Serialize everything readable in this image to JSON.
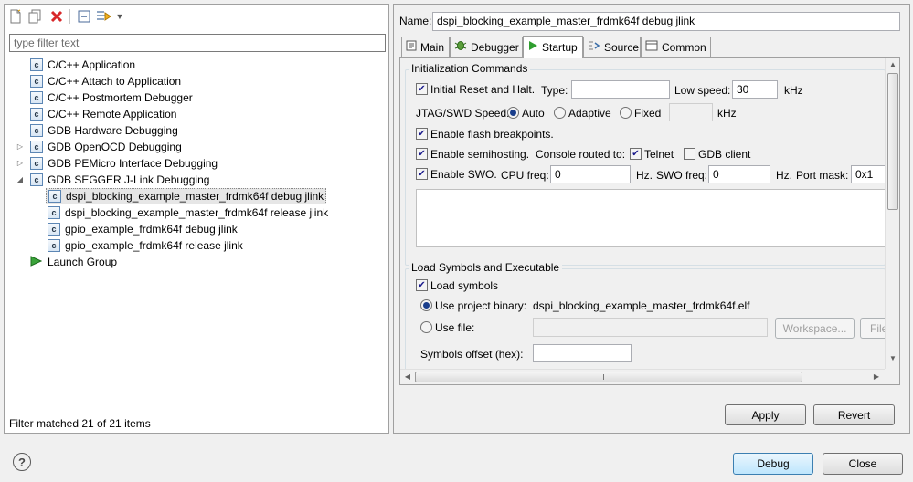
{
  "toolbar": {
    "icons": [
      "new-configuration-icon",
      "duplicate-icon",
      "delete-icon",
      "collapse-all-icon",
      "filter-icon",
      "dropdown-icon"
    ]
  },
  "filter": {
    "placeholder": "type filter text"
  },
  "tree": {
    "items": [
      {
        "label": "C/C++ Application",
        "icon": "c-icon"
      },
      {
        "label": "C/C++ Attach to Application",
        "icon": "c-icon"
      },
      {
        "label": "C/C++ Postmortem Debugger",
        "icon": "c-icon"
      },
      {
        "label": "C/C++ Remote Application",
        "icon": "c-icon"
      },
      {
        "label": "GDB Hardware Debugging",
        "icon": "c-icon"
      },
      {
        "label": "GDB OpenOCD Debugging",
        "icon": "c-icon",
        "expander": "collapsed"
      },
      {
        "label": "GDB PEMicro Interface Debugging",
        "icon": "c-icon",
        "expander": "collapsed"
      },
      {
        "label": "GDB SEGGER J-Link Debugging",
        "icon": "c-icon",
        "expander": "expanded"
      },
      {
        "label": "dspi_blocking_example_master_frdmk64f debug jlink",
        "icon": "c-icon",
        "child": true,
        "selected": true
      },
      {
        "label": "dspi_blocking_example_master_frdmk64f release jlink",
        "icon": "c-icon",
        "child": true
      },
      {
        "label": "gpio_example_frdmk64f debug jlink",
        "icon": "c-icon",
        "child": true
      },
      {
        "label": "gpio_example_frdmk64f release jlink",
        "icon": "c-icon",
        "child": true
      },
      {
        "label": "Launch Group",
        "icon": "launch-icon"
      }
    ]
  },
  "filter_status": "Filter matched 21 of 21 items",
  "name": {
    "label": "Name:",
    "value": "dspi_blocking_example_master_frdmk64f debug jlink"
  },
  "tabs": [
    {
      "label": "Main",
      "icon": "main-icon"
    },
    {
      "label": "Debugger",
      "icon": "debugger-icon"
    },
    {
      "label": "Startup",
      "icon": "startup-icon",
      "active": true
    },
    {
      "label": "Source",
      "icon": "source-icon"
    },
    {
      "label": "Common",
      "icon": "common-icon"
    }
  ],
  "init": {
    "title": "Initialization Commands",
    "initial_reset": {
      "label": "Initial Reset and Halt.",
      "checked": true
    },
    "type_label": "Type:",
    "type_value": "",
    "low_speed_label": "Low speed:",
    "low_speed_value": "30",
    "khz": "kHz",
    "jtag_label": "JTAG/SWD Speed:",
    "speed_options": [
      {
        "label": "Auto",
        "selected": true
      },
      {
        "label": "Adaptive",
        "selected": false
      },
      {
        "label": "Fixed",
        "selected": false
      }
    ],
    "fixed_value": "",
    "khz2": "kHz",
    "flash_bp": {
      "label": "Enable flash breakpoints.",
      "checked": true
    },
    "semihosting": {
      "label": "Enable semihosting.",
      "checked": true
    },
    "console_label": "Console routed to:",
    "telnet": {
      "label": "Telnet",
      "checked": true
    },
    "gdb_client": {
      "label": "GDB client",
      "checked": false
    },
    "swo": {
      "label": "Enable SWO.",
      "checked": true
    },
    "cpu_freq_label": "CPU freq:",
    "cpu_freq_value": "0",
    "hz1": "Hz.",
    "swo_freq_label": "SWO freq:",
    "swo_freq_value": "0",
    "hz2": "Hz.",
    "port_mask_label": "Port mask:",
    "port_mask_value": "0x1",
    "commands_text": ""
  },
  "load": {
    "title": "Load Symbols and Executable",
    "load_symbols": {
      "label": "Load symbols",
      "checked": true
    },
    "use_project": {
      "label": "Use project binary:",
      "selected": true
    },
    "project_binary": "dspi_blocking_example_master_frdmk64f.elf",
    "use_file": {
      "label": "Use file:",
      "selected": false
    },
    "file_value": "",
    "workspace_button": "Workspace...",
    "file_button": "File",
    "offset_label": "Symbols offset (hex):",
    "offset_value": ""
  },
  "buttons": {
    "apply": "Apply",
    "revert": "Revert",
    "debug": "Debug",
    "close": "Close"
  },
  "help_icon": "help-icon"
}
